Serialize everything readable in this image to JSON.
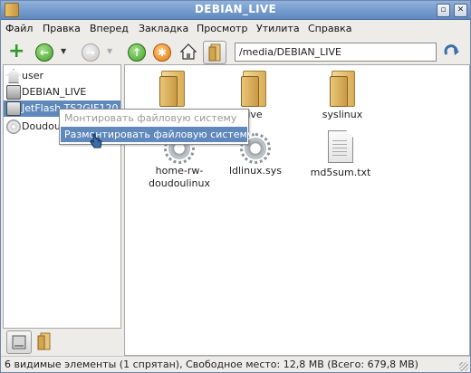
{
  "window": {
    "title": "DEBIAN_LIVE"
  },
  "menubar": {
    "items": [
      "Файл",
      "Правка",
      "Вперед",
      "Закладка",
      "Просмотр",
      "Утилита",
      "Справка"
    ]
  },
  "toolbar": {
    "add_icon": "plus-icon",
    "back_icon": "back-arrow-icon",
    "forward_icon": "forward-arrow-icon",
    "up_icon": "up-arrow-icon",
    "stop_icon": "stop-icon",
    "home_icon": "home-icon",
    "location_toggle_icon": "folder-icon"
  },
  "location": {
    "value": "/media/DEBIAN_LIVE",
    "go_icon": "reload-arrow-icon"
  },
  "sidebar": {
    "items": [
      {
        "label": "user",
        "icon": "home-icon"
      },
      {
        "label": "DEBIAN_LIVE",
        "icon": "drive-icon"
      },
      {
        "label": "JetFlash TS2GJF120",
        "icon": "usb-drive-icon",
        "selected": true
      },
      {
        "label": "Doudou",
        "icon": "optical-disc-icon"
      }
    ]
  },
  "context_menu": {
    "items": [
      {
        "label": "Монтировать файловую систему",
        "disabled": true
      },
      {
        "label": "Размонтировать файловую систему",
        "highlighted": true
      }
    ]
  },
  "files": [
    {
      "name": "",
      "icon": "folder-icon"
    },
    {
      "name": "live",
      "icon": "folder-icon"
    },
    {
      "name": "syslinux",
      "icon": "folder-icon"
    },
    {
      "name": "home-rw-doudoulinux",
      "icon": "gear-file-icon"
    },
    {
      "name": "ldlinux.sys",
      "icon": "gear-file-icon"
    },
    {
      "name": "md5sum.txt",
      "icon": "text-file-icon"
    }
  ],
  "status": {
    "text": "6 видимые элементы (1 спрятан), Свободное место: 12,8 MB (Всего: 679,8 MB)"
  },
  "colors": {
    "selection": "#5f88bd",
    "titlebar": "#6f95c6"
  }
}
